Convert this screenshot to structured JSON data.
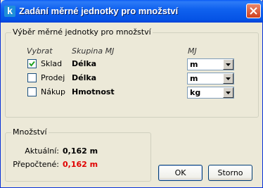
{
  "window": {
    "title": "Zadání měrné jednotky pro množství",
    "app_icon_letter": "k"
  },
  "unit_group": {
    "label": "Výběr měrné jednotky pro množství",
    "headers": {
      "select": "Vybrat",
      "group": "Skupina MJ",
      "unit": "MJ"
    },
    "rows": [
      {
        "label": "Sklad",
        "checked": true,
        "group": "Délka",
        "unit": "m"
      },
      {
        "label": "Prodej",
        "checked": false,
        "group": "Délka",
        "unit": "m"
      },
      {
        "label": "Nákup",
        "checked": false,
        "group": "Hmotnost",
        "unit": "kg"
      }
    ]
  },
  "quantity_group": {
    "label": "Množství",
    "current_label": "Aktuální:",
    "current_value": "0,162 m",
    "converted_label": "Přepočtené:",
    "converted_value": "0,162 m",
    "converted_color": "#e00000"
  },
  "buttons": {
    "ok": "OK",
    "cancel": "Storno"
  }
}
